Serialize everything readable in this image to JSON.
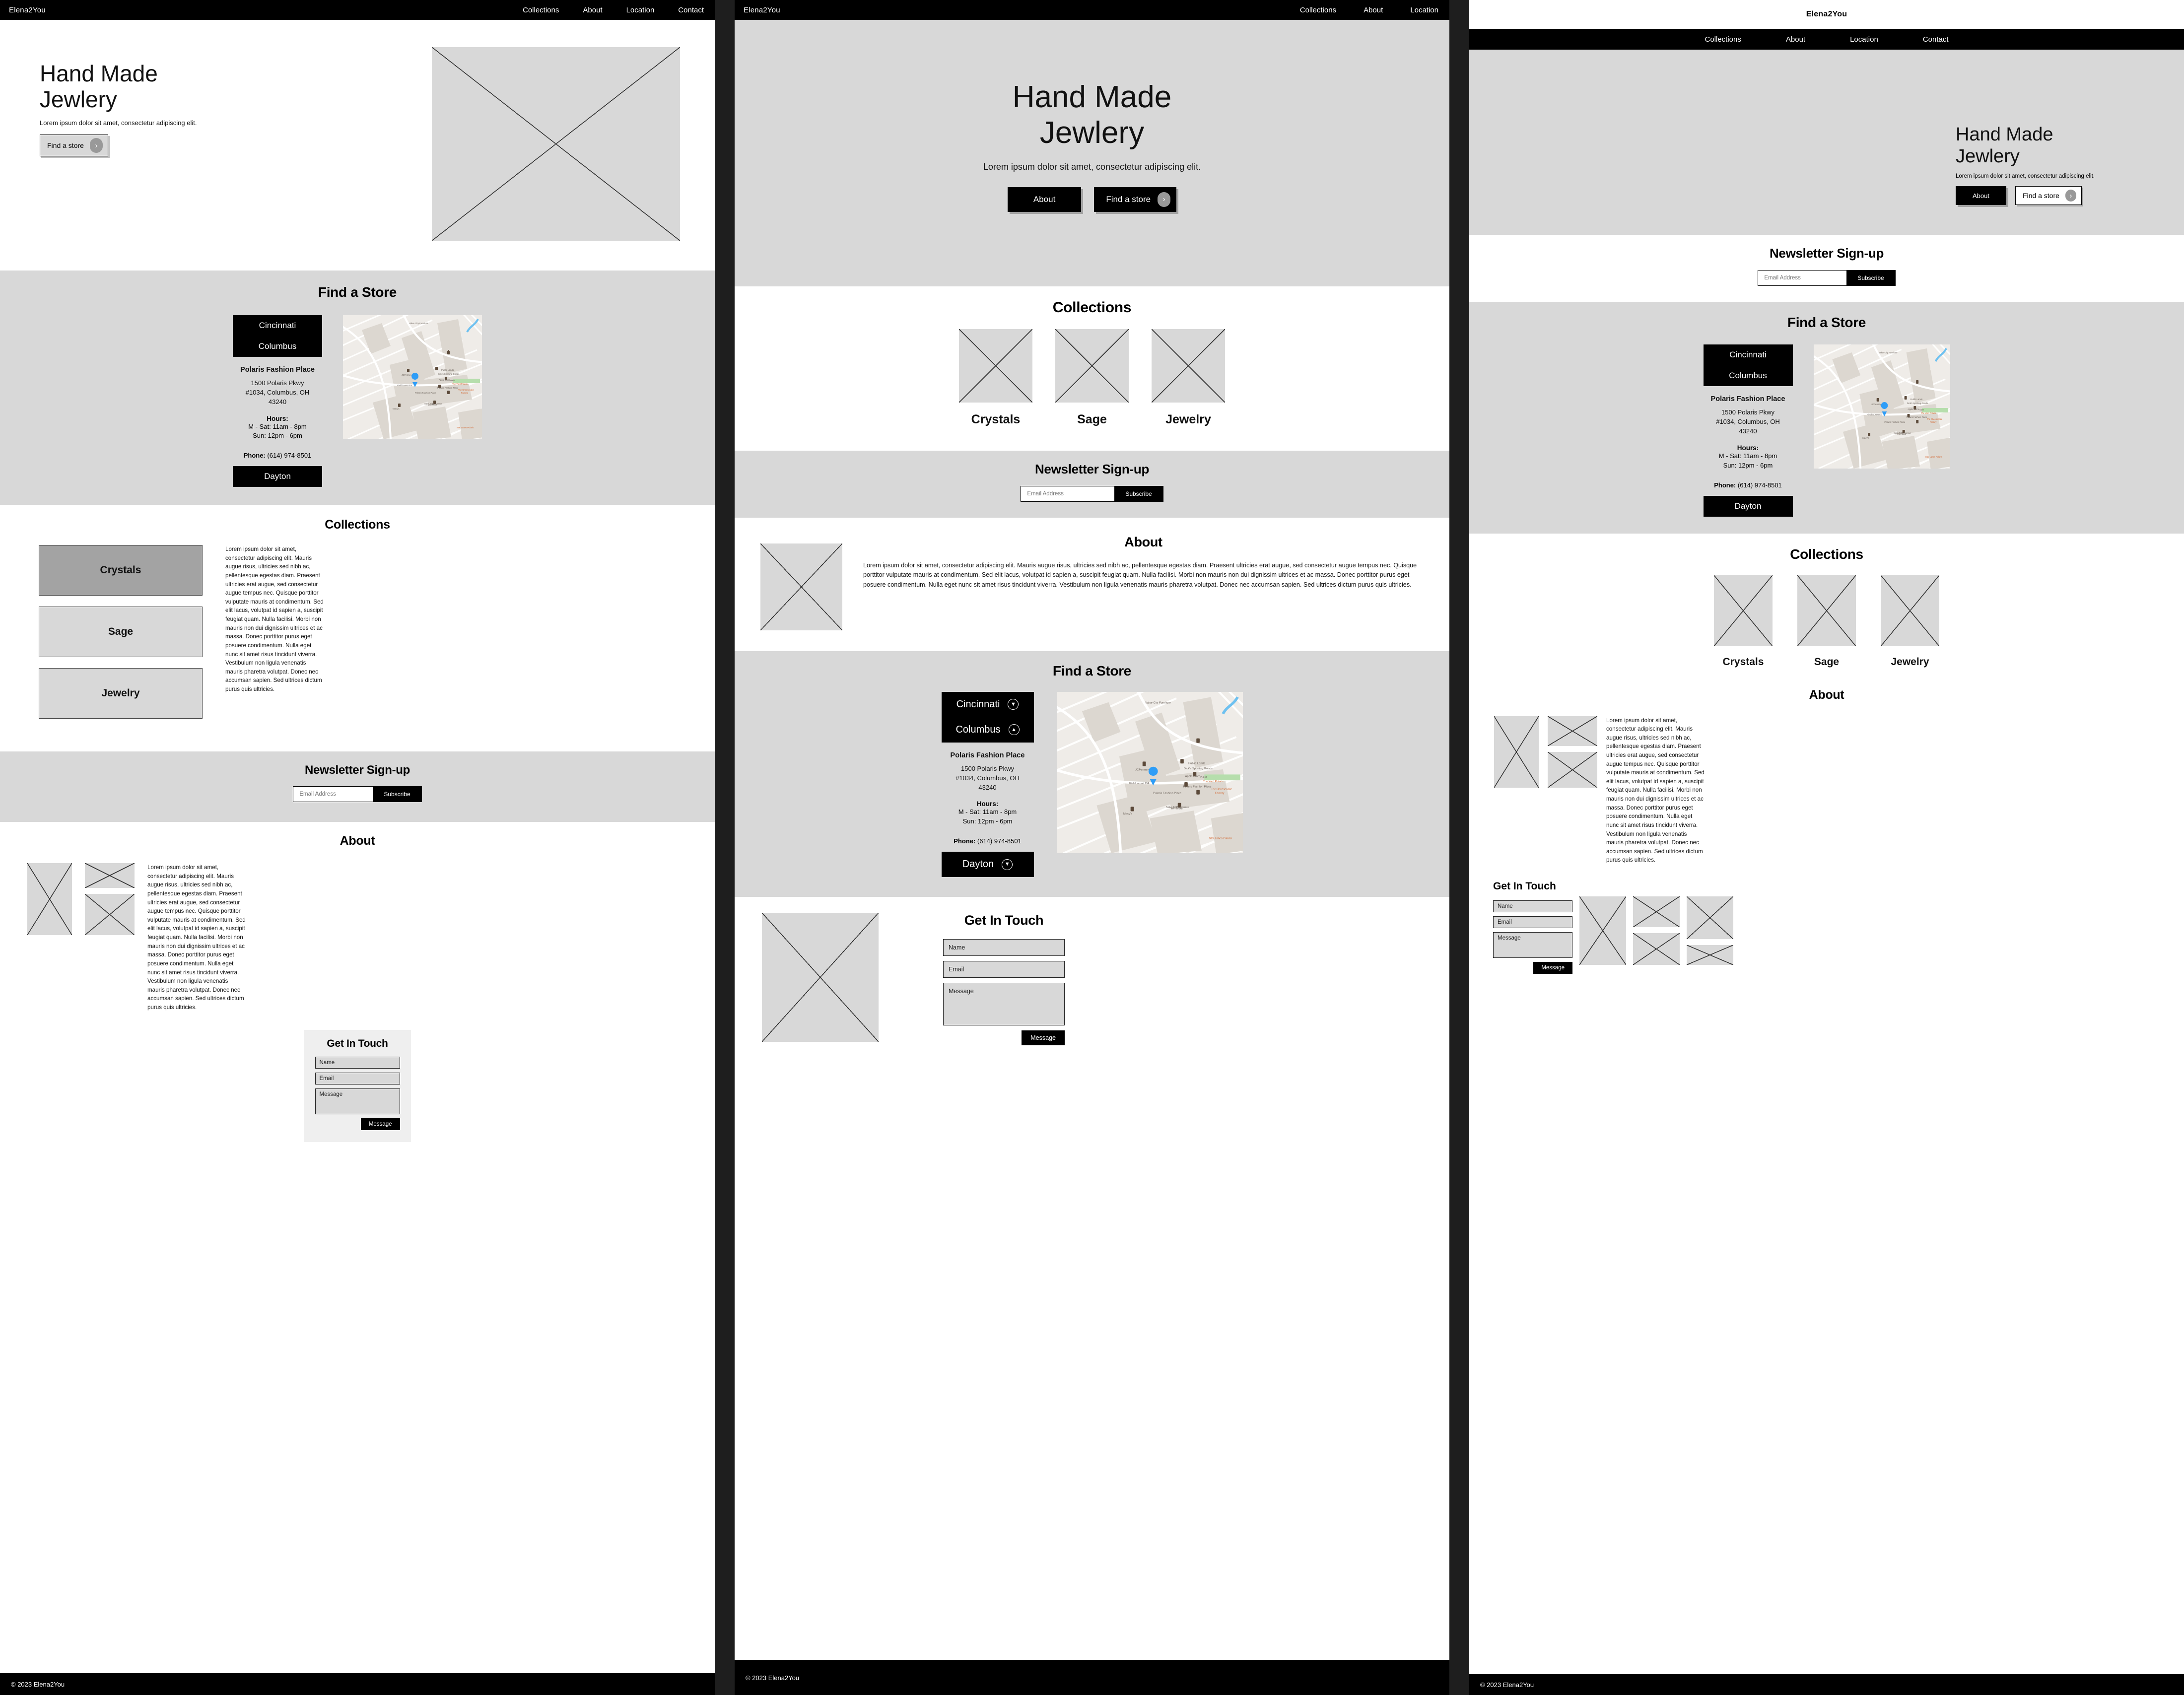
{
  "brand": "Elena2You",
  "nav": {
    "full": [
      "Collections",
      "About",
      "Location",
      "Contact"
    ],
    "panel2": [
      "Collections",
      "About",
      "Location"
    ]
  },
  "hero": {
    "line1": "Hand Made",
    "line2": "Jewlery",
    "sub": "Lorem ipsum dolor sit amet, consectetur adipiscing elit.",
    "find_store": "Find a store",
    "about": "About",
    "chevron_right": "›"
  },
  "sections": {
    "find_store": "Find a Store",
    "collections": "Collections",
    "newsletter": "Newsletter Sign-up",
    "about": "About",
    "get_in_touch": "Get In Touch"
  },
  "store": {
    "city_primary": "Cincinnati",
    "city_secondary": "Columbus",
    "city_tertiary": "Dayton",
    "name": "Polaris Fashion Place",
    "address_line1": "1500 Polaris Pkwy",
    "address_line2": "#1034, Columbus, OH",
    "address_line3": "43240",
    "hours_label": "Hours:",
    "hours_weekday": "M - Sat: 11am - 8pm",
    "hours_sunday": "Sun: 12pm - 6pm",
    "phone_label": "Phone:",
    "phone_value": "(614) 974-8501",
    "chevron_down": "⌄",
    "chevron_up": "⌃"
  },
  "map": {
    "places": [
      "Value City Furniture",
      "Fashion Pl Loop",
      "Public Lands",
      "JCPenney",
      "Dick's Sporting Goods",
      "Apple Store",
      "H&M",
      "The Yard Polaris",
      "The Cheesecake Factory",
      "FieldhouseUSA",
      "Polaris Fashion Place",
      "Von Maur",
      "Macy's",
      "Saks Fifth Avenue",
      "Star Lanes Polaris",
      "Polaris Fashion Place"
    ]
  },
  "collections": {
    "items": [
      "Crystals",
      "Sage",
      "Jewelry"
    ],
    "active_index": 0
  },
  "newsletter": {
    "placeholder": "Email Address",
    "button": "Subscribe"
  },
  "body_copy": "Lorem ipsum dolor sit amet, consectetur adipiscing elit. Mauris augue risus, ultricies sed nibh ac, pellentesque egestas diam. Praesent ultricies erat augue, sed consectetur augue tempus nec. Quisque porttitor vulputate mauris at condimentum. Sed elit lacus, volutpat id sapien a, suscipit feugiat quam. Nulla facilisi. Morbi non mauris non dui dignissim ultrices et ac massa. Donec porttitor purus eget posuere condimentum. Nulla eget nunc sit amet risus tincidunt viverra. Vestibulum non ligula venenatis mauris pharetra volutpat. Donec nec accumsan sapien. Sed ultrices dictum purus quis ultricies.",
  "contact": {
    "name_placeholder": "Name",
    "email_placeholder": "Email",
    "message_placeholder": "Message",
    "submit": "Message"
  },
  "footer": "© 2023 Elena2You",
  "colors": {
    "black": "#000000",
    "grey_section": "#d8d8d8",
    "placeholder": "#d8d8d8",
    "card_active": "#a3a3a3",
    "gutter": "#1e1e1e",
    "map_pin": "#2e9df7"
  }
}
